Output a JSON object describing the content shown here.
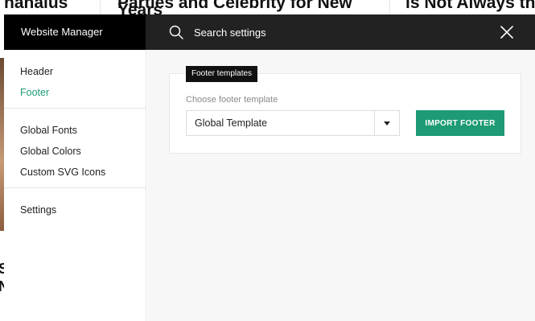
{
  "background_site": {
    "headline_left": "hanalus",
    "headline_center": "Parties and Celebrity for New",
    "headline_center_line2": "Years",
    "headline_right": "is Not Always the",
    "left_glyph_1": "S",
    "left_glyph_2": "N"
  },
  "topbar": {
    "brand": "Website Manager",
    "search_placeholder": "Search settings",
    "search_icon": "search-icon",
    "close_icon": "close-icon"
  },
  "sidebar": {
    "groups": [
      [
        {
          "label": "Header",
          "active": false
        },
        {
          "label": "Footer",
          "active": true
        }
      ],
      [
        {
          "label": "Global Fonts"
        },
        {
          "label": "Global Colors"
        },
        {
          "label": "Custom SVG Icons"
        }
      ],
      [
        {
          "label": "Settings"
        }
      ]
    ]
  },
  "main": {
    "panel_tag": "Footer templates",
    "field_label": "Choose footer template",
    "select_value": "Global Template",
    "import_button": "IMPORT FOOTER"
  },
  "colors": {
    "accent": "#1e9b76",
    "topbar": "#222222",
    "brand_bg": "#000000"
  }
}
